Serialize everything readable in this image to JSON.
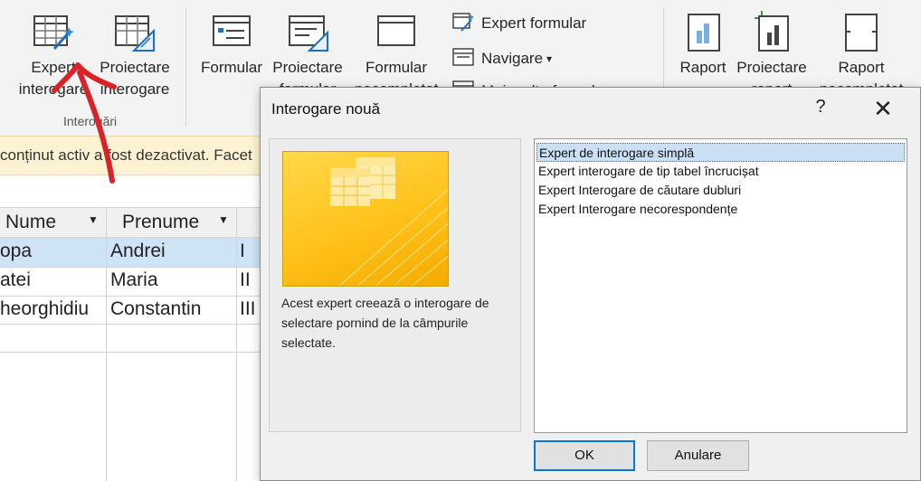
{
  "ribbon": {
    "groups": {
      "queries": {
        "label": "Interogări",
        "query_wizard": {
          "label_line1": "Expert",
          "label_line2": "interogare"
        },
        "query_design": {
          "label_line1": "Proiectare",
          "label_line2": "interogare"
        }
      },
      "forms": {
        "form": {
          "label": "Formular"
        },
        "form_design": {
          "label_line1": "Proiectare",
          "label_line2": "formular"
        },
        "blank_form": {
          "label_line1": "Formular",
          "label_line2": "necompletat"
        },
        "form_wizard": {
          "label": "Expert formular"
        },
        "navigation": {
          "label": "Navigare"
        },
        "more_forms": {
          "label": "Mai multe formulare"
        }
      },
      "reports": {
        "report": {
          "label": "Raport"
        },
        "report_design": {
          "label_line1": "Proiectare",
          "label_line2": "raport"
        },
        "blank_report": {
          "label_line1": "Raport",
          "label_line2": "necompletat"
        }
      }
    }
  },
  "message_bar": {
    "text": "conținut activ a fost dezactivat. Facet"
  },
  "table": {
    "headers": [
      "Nume",
      "Prenume"
    ],
    "rows": [
      {
        "nume": "opa",
        "prenume": "Andrei",
        "extra": "I"
      },
      {
        "nume": "atei",
        "prenume": "Maria",
        "extra": "II"
      },
      {
        "nume": "heorghidiu",
        "prenume": "Constantin",
        "extra": "III"
      }
    ]
  },
  "dialog": {
    "title": "Interogare nouă",
    "help": "?",
    "close": "✕",
    "description": "Acest expert creează o interogare de selectare pornind de la câmpurile selectate.",
    "options": [
      "Expert de interogare simplă",
      "Expert interogare de tip tabel încrucișat",
      "Expert Interogare de căutare dubluri",
      "Expert Interogare necorespondențe"
    ],
    "selected_index": 0,
    "ok_label": "OK",
    "cancel_label": "Anulare"
  },
  "colors": {
    "annotation_arrow": "#d9232b",
    "selected_row": "#cfe3f6",
    "message_bar": "#fdf3d3",
    "focus_border": "#0078d7"
  }
}
